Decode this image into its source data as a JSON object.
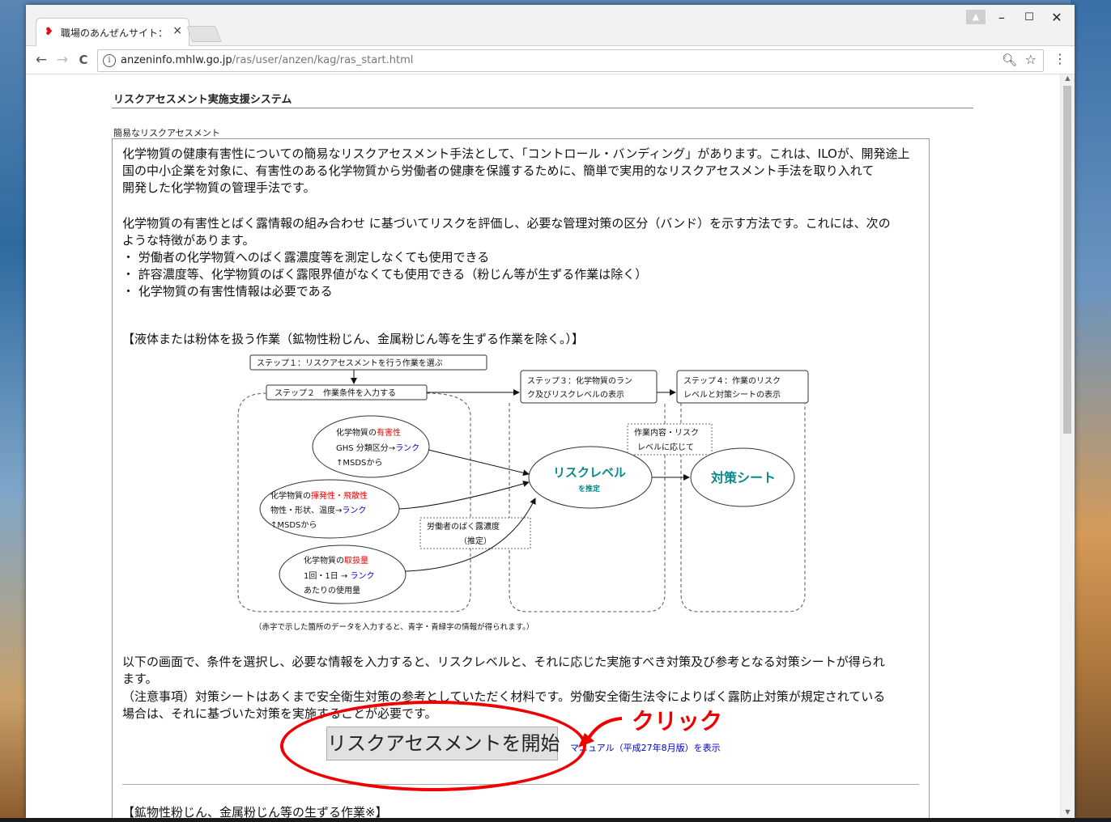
{
  "window": {
    "tab_title": "職場のあんぜんサイト：化学",
    "tab_close": "×",
    "minimize": "–",
    "maximize": "☐",
    "close": "✕"
  },
  "toolbar": {
    "back": "←",
    "forward": "→",
    "reload": "C",
    "url_host": "anzeninfo.mhlw.go.jp",
    "url_path": "/ras/user/anzen/kag/ras_start.html"
  },
  "page": {
    "site_title": "リスクアセスメント実施支援システム",
    "section_label": "簡易なリスクアセスメント",
    "intro_lines": [
      "化学物質の健康有害性についての簡易なリスクアセスメント手法として、「コントロール・バンディング」があります。これは、ILOが、開発途上",
      "国の中小企業を対象に、有害性のある化学物質から労働者の健康を保護するために、簡単で実用的なリスクアセスメント手法を取り入れて",
      "開発した化学物質の管理手法です。"
    ],
    "method_lines": [
      "化学物質の有害性とばく露情報の組み合わせ に基づいてリスクを評価し、必要な管理対策の区分（バンド）を示す方法です。これには、次の",
      "ような特徴があります。",
      "・ 労働者の化学物質へのばく露濃度等を測定しなくても使用できる",
      "・ 許容濃度等、化学物質のばく露限界値がなくても使用できる（粉じん等が生ずる作業は除く）",
      "・ 化学物質の有害性情報は必要である"
    ],
    "liquid_heading": "【液体または粉体を扱う作業（鉱物性粉じん、金属粉じん等を生ずる作業を除く。）】",
    "diagram": {
      "step1": "ステップ１：リスクアセスメントを行う作業を選ぶ",
      "step2": "ステップ２　作業条件を入力する",
      "step3_a": "ステップ３：化学物質のラン",
      "step3_b": "ク及びリスクレベルの表示",
      "step4_a": "ステップ４：作業のリスク",
      "step4_b": "レベルと対策シートの表示",
      "e1_a": "化学物質の",
      "e1_red": "有害性",
      "e1_b": "GHS 分類区分→",
      "e1_blue": "ランク",
      "e1_c": "↑MSDSから",
      "e2_a": "化学物質の",
      "e2_red": "揮発性・飛散性",
      "e2_b": "物性・形状、温度→",
      "e2_blue": "ランク",
      "e2_c": "↑MSDSから",
      "e3_a": "化学物質の",
      "e3_red": "取扱量",
      "e3_b": "1回・1日 → ",
      "e3_blue": "ランク",
      "e3_c": "あたりの使用量",
      "exposure_a": "労働者のばく露濃度",
      "exposure_b": "（推定）",
      "work_a": "作業内容・リスク",
      "work_b": "レベルに応じて",
      "risk_a": "リスクレベル",
      "risk_b": "を推定",
      "sheet": "対策シート",
      "caption": "（赤字で示した箇所のデータを入力すると、青字・青緑字の情報が得られます。）"
    },
    "after_lines": [
      "以下の画面で、条件を選択し、必要な情報を入力すると、リスクレベルと、それに応じた実施すべき対策及び参考となる対策シートが得られ",
      "ます。",
      "（注意事項）対策シートはあくまで安全衛生対策の参考としていただく材料です。労働安全衛生法令によりばく露防止対策が規定されている",
      "場合は、それに基づいた対策を実施することが必要です。"
    ],
    "start_button": "リスクアセスメントを開始",
    "manual_link": "マニュアル（平成27年8月版）を表示",
    "mineral_heading": "【鉱物性粉じん、金属粉じん等の生ずる作業※】"
  },
  "annotation": {
    "click_label": "クリック",
    "color": "#e00000"
  }
}
